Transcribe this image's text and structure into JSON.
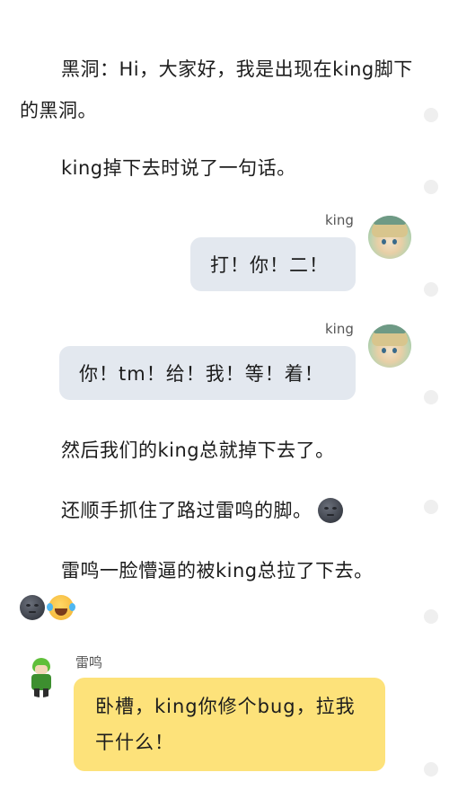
{
  "story": {
    "para1": "黑洞：Hi，大家好，我是出现在king脚下的黑洞。",
    "para2": "king掉下去时说了一句话。",
    "para3": "然后我们的king总就掉下去了。",
    "para4": "还顺手抓住了路过雷鸣的脚。",
    "para5": "雷鸣一脸懵逼的被king总拉了下去。"
  },
  "messages": [
    {
      "sender": "king",
      "text": "打！你！二！"
    },
    {
      "sender": "king",
      "text": "你！tm！给！我！等！着！"
    },
    {
      "sender": "雷鸣",
      "text": "卧槽，king你修个bug，拉我干什么！"
    }
  ],
  "emojis": [
    "new-moon-face",
    "new-moon-face",
    "tears-of-joy"
  ],
  "colors": {
    "king_bubble": "#e3e8ef",
    "lei_bubble": "#fde27a"
  }
}
